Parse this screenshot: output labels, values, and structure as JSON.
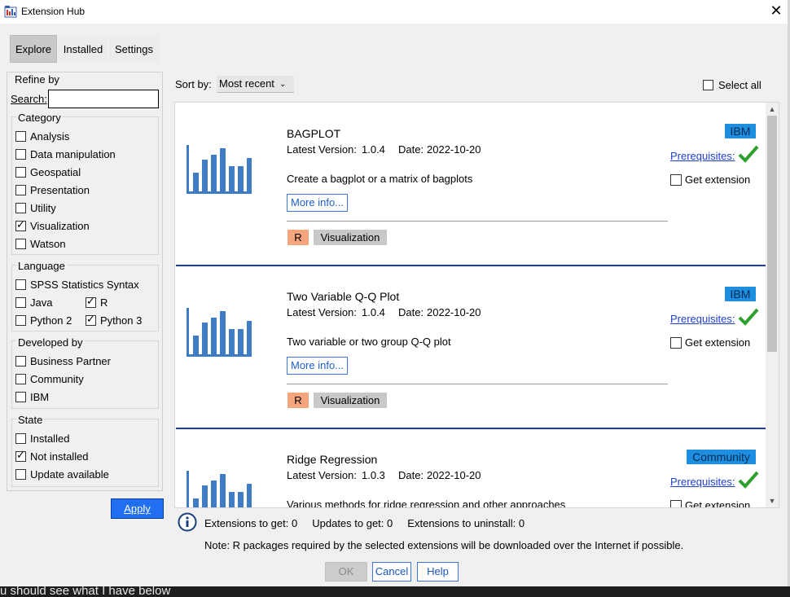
{
  "window": {
    "title": "Extension Hub",
    "close_glyph": "✕",
    "icon": "extension-hub-icon"
  },
  "tabs": [
    {
      "label": "Explore",
      "active": true
    },
    {
      "label": "Installed"
    },
    {
      "label": "Settings"
    }
  ],
  "refine": {
    "title": "Refine by",
    "search_label": "Search:",
    "search_value": "",
    "groups": [
      {
        "title": "Category",
        "items": [
          {
            "label": "Analysis",
            "checked": false
          },
          {
            "label": "Data manipulation",
            "checked": false
          },
          {
            "label": "Geospatial",
            "checked": false
          },
          {
            "label": "Presentation",
            "checked": false
          },
          {
            "label": "Utility",
            "checked": false
          },
          {
            "label": "Visualization",
            "checked": true
          },
          {
            "label": "Watson",
            "checked": false
          }
        ]
      },
      {
        "title": "Language",
        "items": [
          {
            "label": "SPSS Statistics Syntax",
            "checked": false
          },
          {
            "label": "Java",
            "checked": false
          },
          {
            "label": "R",
            "checked": true
          },
          {
            "label": "Python 2",
            "checked": false
          },
          {
            "label": "Python 3",
            "checked": true
          }
        ]
      },
      {
        "title": "Developed by",
        "items": [
          {
            "label": "Business Partner",
            "checked": false
          },
          {
            "label": "Community",
            "checked": false
          },
          {
            "label": "IBM",
            "checked": false
          }
        ]
      },
      {
        "title": "State",
        "items": [
          {
            "label": "Installed",
            "checked": false
          },
          {
            "label": "Not installed",
            "checked": true
          },
          {
            "label": "Update available",
            "checked": false
          }
        ]
      }
    ],
    "apply_label": "Apply"
  },
  "sort": {
    "label": "Sort by:",
    "value": "Most recent"
  },
  "select_all": {
    "label": "Select all",
    "checked": false
  },
  "extensions": [
    {
      "name": "BAGPLOT",
      "version_label": "Latest Version:",
      "version": "1.0.4",
      "date_label": "Date:",
      "date": "2022-10-20",
      "description": "Create a bagplot or a matrix of bagplots",
      "more_info": "More info...",
      "language_tag": "R",
      "category_tag": "Visualization",
      "developer": "IBM",
      "prerequisites": "Prerequisites:",
      "get_extension": "Get extension"
    },
    {
      "name": "Two Variable Q-Q Plot",
      "version_label": "Latest Version:",
      "version": "1.0.4",
      "date_label": "Date:",
      "date": "2022-10-20",
      "description": "Two variable or two group Q-Q plot",
      "more_info": "More info...",
      "language_tag": "R",
      "category_tag": "Visualization",
      "developer": "IBM",
      "prerequisites": "Prerequisites:",
      "get_extension": "Get extension"
    },
    {
      "name": "Ridge Regression",
      "version_label": "Latest Version:",
      "version": "1.0.3",
      "date_label": "Date:",
      "date": "2022-10-20",
      "description": "Various methods for ridge regression and other approaches",
      "developer": "Community",
      "prerequisites": "Prerequisites:",
      "get_extension": "Get extension"
    }
  ],
  "summary": {
    "text": "Extensions to get: 0     Updates to get: 0     Extensions to uninstall: 0",
    "note": "Note: R packages required by the selected extensions will be downloaded over the Internet if possible."
  },
  "buttons": {
    "ok": "OK",
    "cancel": "Cancel",
    "help": "Help"
  },
  "background_text": "u should see what I have below",
  "colors": {
    "accent": "#1f6ff0",
    "developer_badge": "#1e8fe0",
    "card_divider": "#1d3fa3",
    "r_tag": "#f4a57c",
    "check_green": "#2ca02c"
  }
}
